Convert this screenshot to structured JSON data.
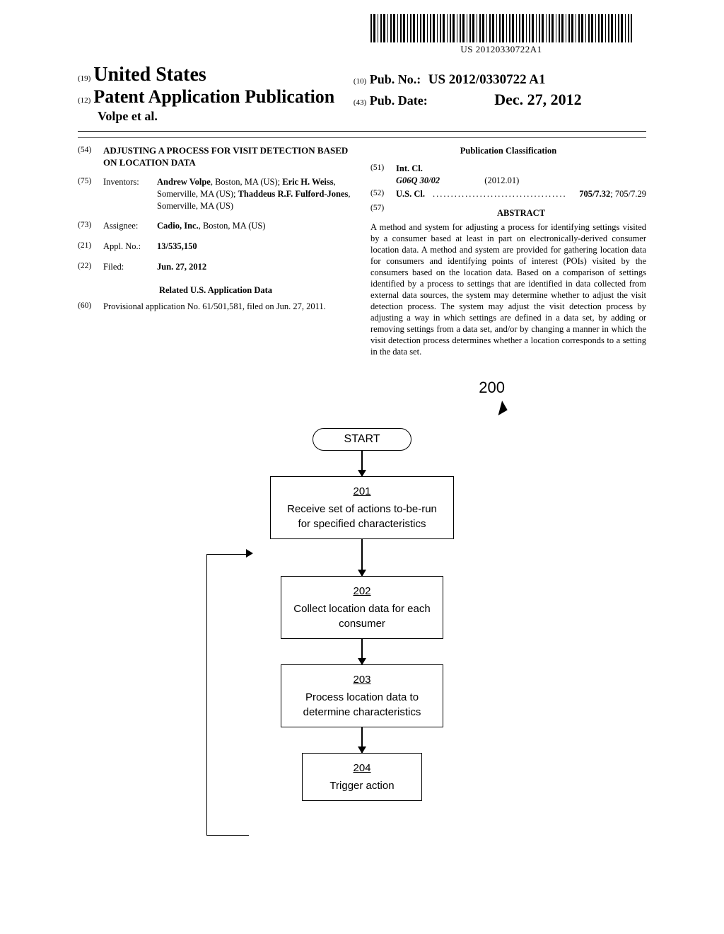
{
  "barcode_text": "US 20120330722A1",
  "header": {
    "num19": "(19)",
    "country": "United States",
    "num12": "(12)",
    "pub_title": "Patent Application Publication",
    "authors": "Volpe et al.",
    "num10": "(10)",
    "pub_no_label": "Pub. No.:",
    "pub_no": "US 2012/0330722 A1",
    "num43": "(43)",
    "pub_date_label": "Pub. Date:",
    "pub_date": "Dec. 27, 2012"
  },
  "left_col": {
    "f54": {
      "num": "(54)",
      "text": "ADJUSTING A PROCESS FOR VISIT DETECTION BASED ON LOCATION DATA"
    },
    "f75": {
      "num": "(75)",
      "label": "Inventors:",
      "names": [
        {
          "bold": "Andrew Volpe",
          "rest": ", Boston, MA (US); "
        },
        {
          "bold": "Eric H. Weiss",
          "rest": ", Somerville, MA (US); "
        },
        {
          "bold": "Thaddeus R.F. Fulford-Jones",
          "rest": ", Somerville, MA (US)"
        }
      ]
    },
    "f73": {
      "num": "(73)",
      "label": "Assignee:",
      "bold": "Cadio, Inc.",
      "rest": ", Boston, MA (US)"
    },
    "f21": {
      "num": "(21)",
      "label": "Appl. No.:",
      "val": "13/535,150"
    },
    "f22": {
      "num": "(22)",
      "label": "Filed:",
      "val": "Jun. 27, 2012"
    },
    "related_title": "Related U.S. Application Data",
    "f60": {
      "num": "(60)",
      "text": "Provisional application No. 61/501,581, filed on Jun. 27, 2011."
    }
  },
  "right_col": {
    "pub_class_title": "Publication Classification",
    "f51": {
      "num": "(51)",
      "label": "Int. Cl.",
      "code": "G06Q 30/02",
      "year": "(2012.01)"
    },
    "f52": {
      "num": "(52)",
      "label": "U.S. Cl.",
      "val_bold": "705/7.32",
      "val_rest": "; 705/7.29"
    },
    "f57": {
      "num": "(57)",
      "title": "ABSTRACT"
    },
    "abstract": "A method and system for adjusting a process for identifying settings visited by a consumer based at least in part on electronically-derived consumer location data. A method and system are provided for gathering location data for consumers and identifying points of interest (POIs) visited by the consumers based on the location data. Based on a comparison of settings identified by a process to settings that are identified in data collected from external data sources, the system may determine whether to adjust the visit detection process. The system may adjust the visit detection process by adjusting a way in which settings are defined in a data set, by adding or removing settings from a data set, and/or by changing a manner in which the visit detection process determines whether a location corresponds to a setting in the data set."
  },
  "figure": {
    "label": "200",
    "start": "START",
    "s201": {
      "num": "201",
      "text": "Receive set of actions to-be-run for specified characteristics"
    },
    "s202": {
      "num": "202",
      "text": "Collect location data for each consumer"
    },
    "s203": {
      "num": "203",
      "text": "Process location data to determine characteristics"
    },
    "s204": {
      "num": "204",
      "text": "Trigger action"
    }
  }
}
